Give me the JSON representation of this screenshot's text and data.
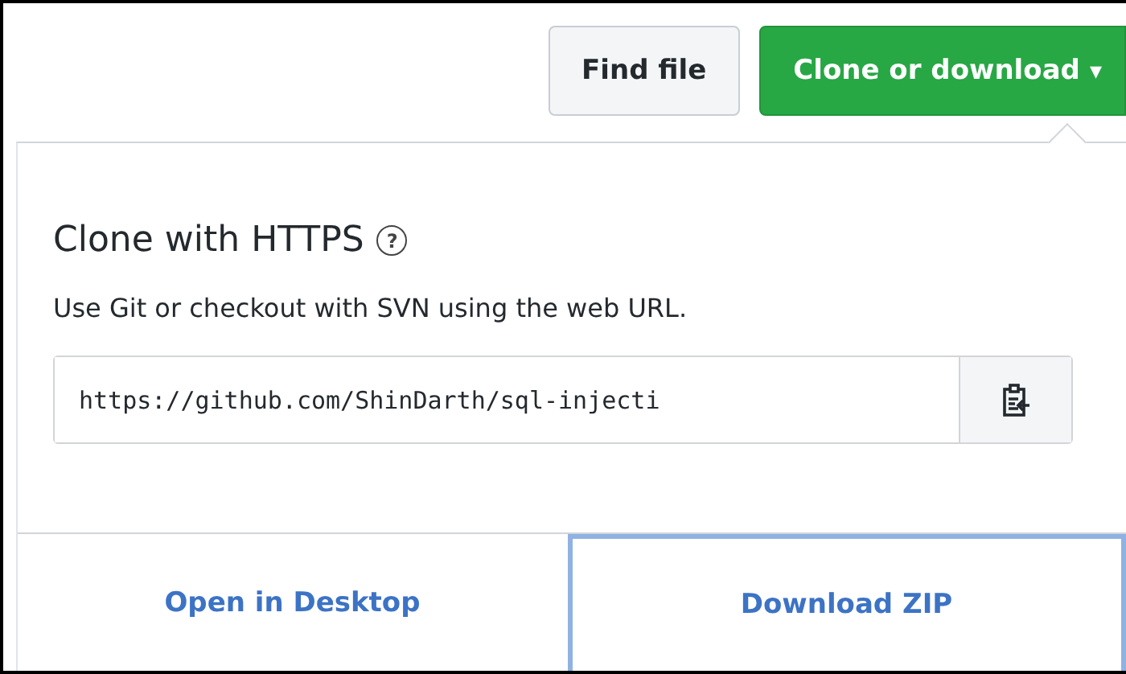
{
  "toolbar": {
    "buttons": [
      {
        "label": "Find file",
        "kind": "plain"
      },
      {
        "label": "Clone or download",
        "kind": "primary",
        "caret": "▾"
      }
    ]
  },
  "clone_panel": {
    "title": "Clone with HTTPS",
    "help": "?",
    "description": "Use Git or checkout with SVN using the web URL.",
    "url": "https://github.com/ShinDarth/sql-injecti"
  },
  "actions": [
    {
      "label": "Open in Desktop",
      "focused": false
    },
    {
      "label": "Download ZIP",
      "focused": true
    }
  ]
}
